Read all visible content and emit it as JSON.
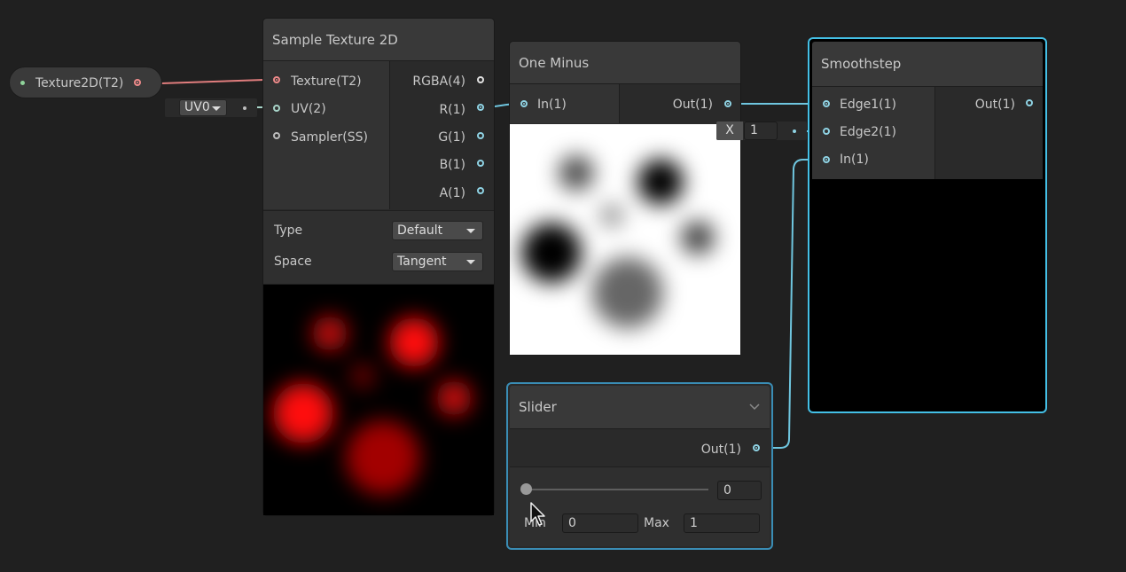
{
  "property_node": {
    "label": "Texture2D(T2)"
  },
  "uv_dropdown": {
    "value": "UV0"
  },
  "sample_texture": {
    "title": "Sample Texture 2D",
    "inputs": [
      "Texture(T2)",
      "UV(2)",
      "Sampler(SS)"
    ],
    "outputs": [
      "RGBA(4)",
      "R(1)",
      "G(1)",
      "B(1)",
      "A(1)"
    ],
    "type_label": "Type",
    "type_value": "Default",
    "space_label": "Space",
    "space_value": "Tangent"
  },
  "one_minus": {
    "title": "One Minus",
    "input": "In(1)",
    "output": "Out(1)"
  },
  "smoothstep": {
    "title": "Smoothstep",
    "inputs": [
      "Edge1(1)",
      "Edge2(1)",
      "In(1)"
    ],
    "output": "Out(1)",
    "edge2_axis": "X",
    "edge2_value": "1"
  },
  "slider": {
    "title": "Slider",
    "output": "Out(1)",
    "value": "0",
    "min_label": "Min",
    "min_value": "0",
    "max_label": "Max",
    "max_value": "1",
    "fraction": 0
  },
  "colors": {
    "background": "#202020",
    "node_body": "#2a2a2a",
    "node_header": "#393939",
    "selection": "#44c0e6",
    "float_port": "#8fd3e4",
    "texture_port": "#ee8a8a",
    "vector_port": "#e0e0e0"
  }
}
